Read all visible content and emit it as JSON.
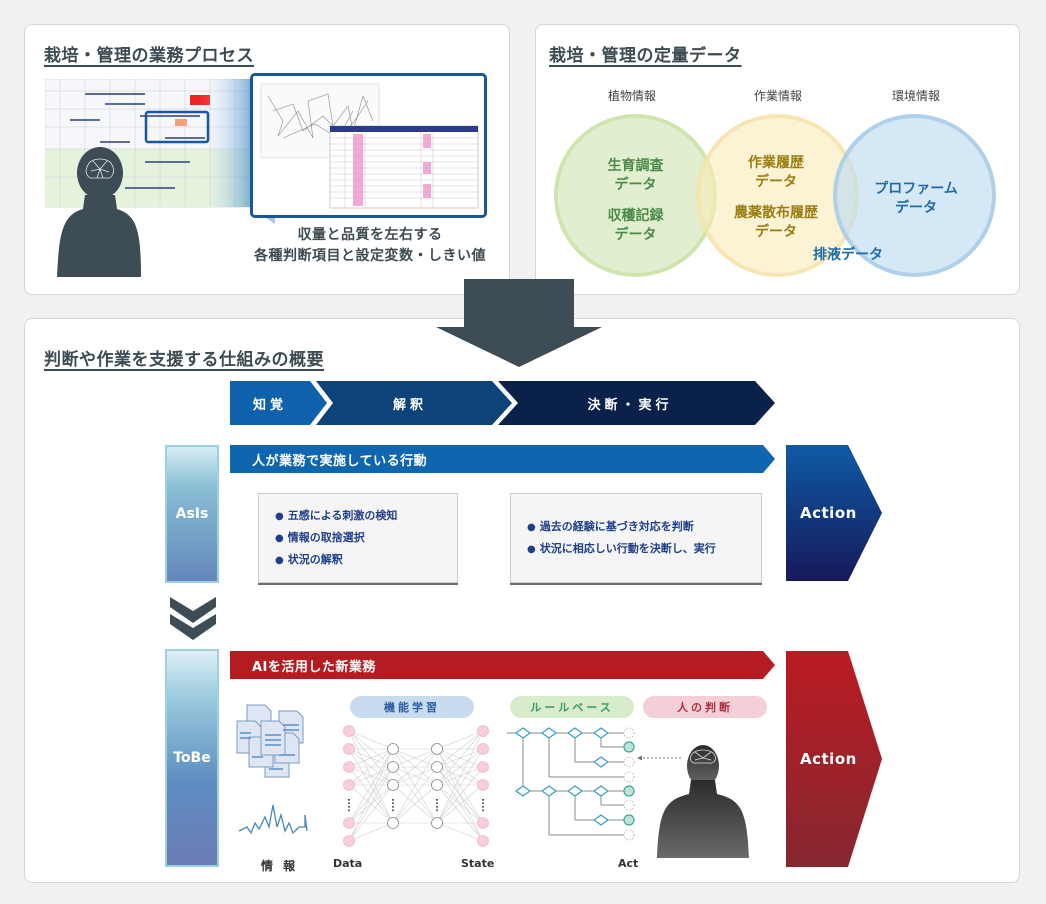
{
  "process_card": {
    "title": "栽培・管理の業務プロセス",
    "caption_line1": "収量と品質を左右する",
    "caption_line2": "各種判断項目と設定変数・しきい値"
  },
  "quant_card": {
    "title": "栽培・管理の定量データ",
    "categories": [
      {
        "heading": "植物情報",
        "items": [
          "生育調査\nデータ",
          "収穫記録\nデータ"
        ],
        "color": "#4c8a4a"
      },
      {
        "heading": "作業情報",
        "items": [
          "作業履歴\nデータ",
          "農薬散布履歴\nデータ"
        ],
        "color": "#9b7d12"
      },
      {
        "heading": "環境情報",
        "items": [
          "プロファーム\nデータ"
        ],
        "color": "#1e6aa8"
      }
    ],
    "overlap_label": "排液データ"
  },
  "overview_card": {
    "title": "判断や作業を支援する仕組みの概要",
    "stages": [
      "知覚",
      "解釈",
      "決断・実行"
    ],
    "asis": {
      "label": "AsIs",
      "band": "人が業務で実施している行動",
      "box1": [
        "五感による刺激の検知",
        "情報の取捨選択",
        "状況の解釈"
      ],
      "box2": [
        "過去の経験に基づき対応を判断",
        "状況に相応しい行動を決断し、実行"
      ],
      "action": "Action"
    },
    "tobe": {
      "label": "ToBe",
      "band": "AIを活用した新業務",
      "pills": {
        "ml": "機能学習",
        "rule": "ルールベース",
        "human": "人の判断"
      },
      "labels": {
        "info": "情 報",
        "data": "Data",
        "state": "State",
        "act": "Act"
      },
      "action": "Action"
    }
  },
  "colors": {
    "dark_slate": "#3d4c55",
    "stage1": "#0e62ac",
    "stage2": "#0e437a",
    "stage3": "#0a2249",
    "asis_band": "#0f66ae",
    "tobe_band": "#b51c22",
    "ml_pill": "#c9dcef",
    "rule_pill": "#d7eccb",
    "human_pill": "#f4cfd6"
  }
}
